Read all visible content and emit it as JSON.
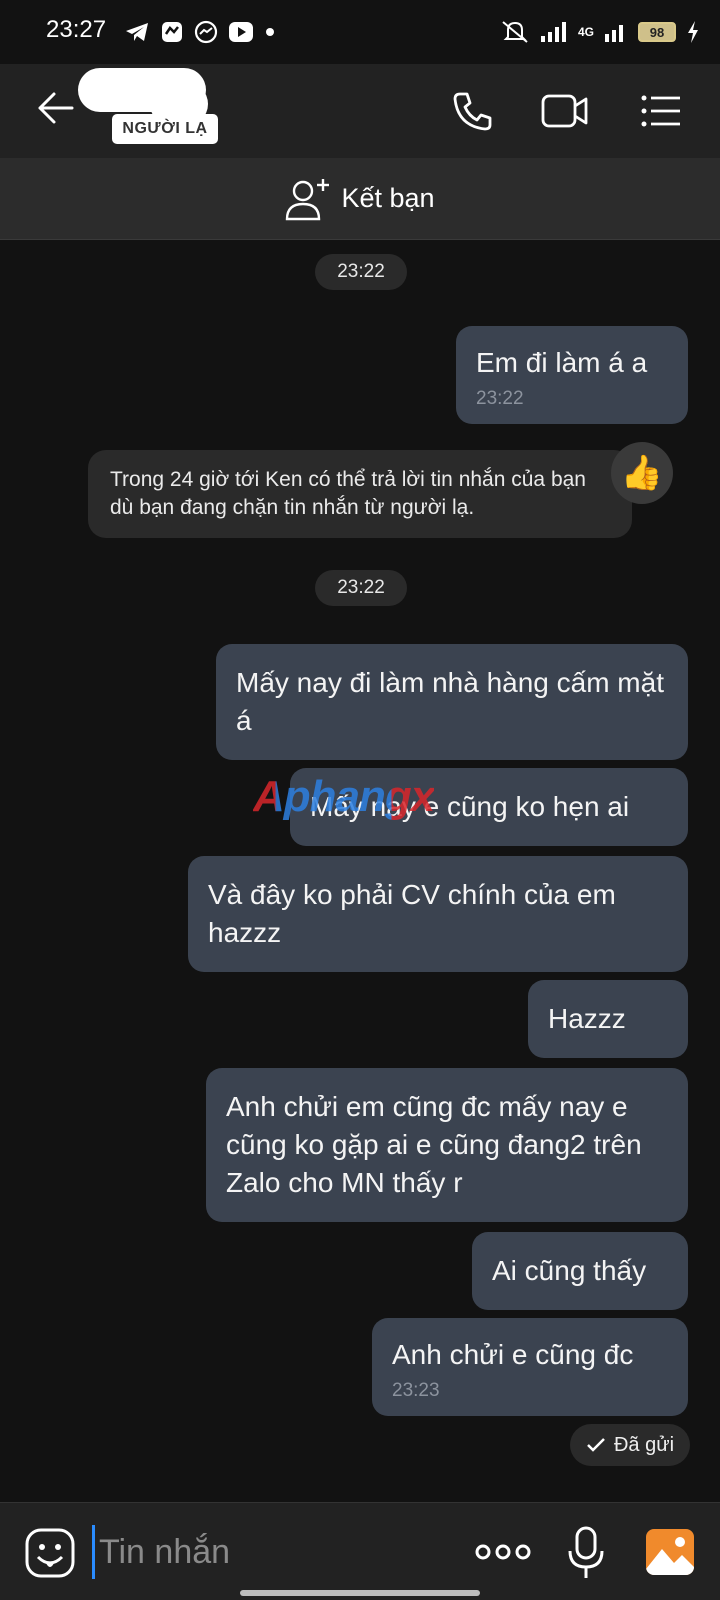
{
  "status_bar": {
    "time": "23:27",
    "network": "4G",
    "battery": "98",
    "icons_left": [
      "telegram-icon",
      "app-icon",
      "messenger-icon",
      "youtube-icon",
      "dot-icon"
    ],
    "icons_right": [
      "mute-icon",
      "signal-icon",
      "signal-4g-icon",
      "battery-icon",
      "charging-icon"
    ]
  },
  "header": {
    "stranger_label": "NGƯỜI LẠ",
    "icons": [
      "back-arrow-icon",
      "phone-icon",
      "video-call-icon",
      "menu-list-icon"
    ]
  },
  "add_friend": {
    "label": "Kết bạn"
  },
  "messages": {
    "time_pill_1": "23:22",
    "msg1": {
      "text": "Em đi làm á a",
      "time": "23:22"
    },
    "system_notice": "Trong 24 giờ tới Ken có thể trả lời tin nhắn của bạn dù bạn đang chặn tin nhắn từ người lạ.",
    "reaction": "👍",
    "time_pill_2": "23:22",
    "msg2": "Mấy nay đi làm nhà hàng cấm mặt á",
    "msg3": "Mấy nay e cũng ko hẹn ai",
    "msg4": "Và đây ko phải CV chính của em hazzz",
    "msg5": "Hazzz",
    "msg6": "Anh chửi em cũng đc mấy nay e cũng ko gặp ai e cũng đang2 trên Zalo cho MN thấy r",
    "msg7": "Ai cũng thấy",
    "msg8": {
      "text": "Anh chửi e cũng đc",
      "time": "23:23"
    },
    "sent_status": "Đã gửi"
  },
  "watermark": "Aphangx",
  "input_bar": {
    "placeholder": "Tin nhắn",
    "icons": [
      "emoji-icon",
      "more-icon",
      "microphone-icon",
      "photo-icon"
    ]
  },
  "colors": {
    "background": "#121212",
    "header": "#222222",
    "bubble": "#3b4350",
    "accent_cursor": "#2a8cff",
    "photo_button": "#f08a2c"
  }
}
